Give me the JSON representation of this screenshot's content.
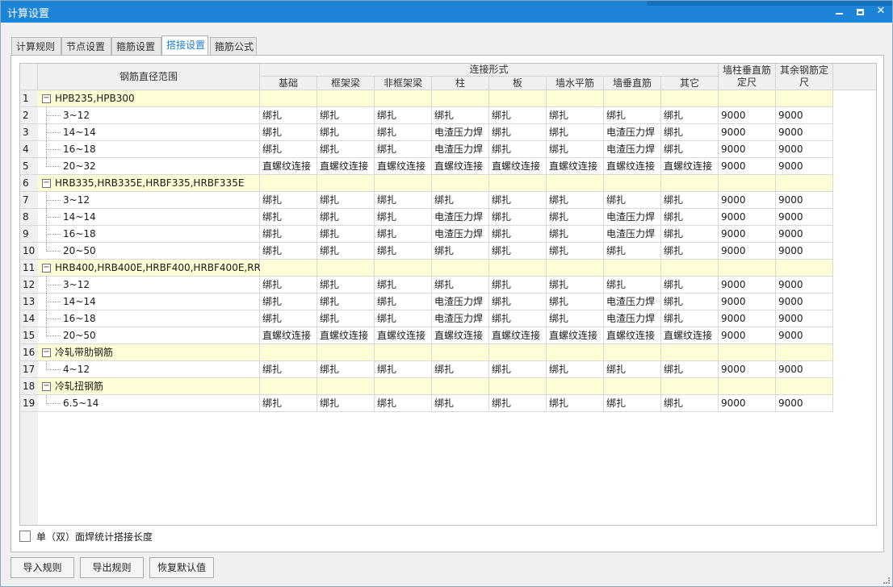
{
  "window": {
    "title": "计算设置"
  },
  "tabs": [
    {
      "label": "计算规则"
    },
    {
      "label": "节点设置"
    },
    {
      "label": "箍筋设置"
    },
    {
      "label": "搭接设置",
      "active": true
    },
    {
      "label": "箍筋公式"
    }
  ],
  "table": {
    "header": {
      "diameter_range": "钢筋直径范围",
      "connection_form": "连接形式",
      "columns": [
        "基础",
        "框架梁",
        "非框架梁",
        "柱",
        "板",
        "墙水平筋",
        "墙垂直筋",
        "其它"
      ],
      "wall_col_length": "墙柱垂直筋定尺",
      "other_length": "其余钢筋定尺"
    },
    "rows": [
      {
        "num": "1",
        "group": true,
        "label": "HPB235,HPB300"
      },
      {
        "num": "2",
        "label": "3~12",
        "cells": [
          "绑扎",
          "绑扎",
          "绑扎",
          "绑扎",
          "绑扎",
          "绑扎",
          "绑扎",
          "绑扎",
          "9000",
          "9000"
        ]
      },
      {
        "num": "3",
        "label": "14~14",
        "cells": [
          "绑扎",
          "绑扎",
          "绑扎",
          "电渣压力焊",
          "绑扎",
          "绑扎",
          "电渣压力焊",
          "绑扎",
          "9000",
          "9000"
        ]
      },
      {
        "num": "4",
        "label": "16~18",
        "cells": [
          "绑扎",
          "绑扎",
          "绑扎",
          "电渣压力焊",
          "绑扎",
          "绑扎",
          "电渣压力焊",
          "绑扎",
          "9000",
          "9000"
        ]
      },
      {
        "num": "5",
        "label": "20~32",
        "cells": [
          "直螺纹连接",
          "直螺纹连接",
          "直螺纹连接",
          "直螺纹连接",
          "直螺纹连接",
          "直螺纹连接",
          "直螺纹连接",
          "直螺纹连接",
          "9000",
          "9000"
        ]
      },
      {
        "num": "6",
        "group": true,
        "label": "HRB335,HRB335E,HRBF335,HRBF335E"
      },
      {
        "num": "7",
        "label": "3~12",
        "cells": [
          "绑扎",
          "绑扎",
          "绑扎",
          "绑扎",
          "绑扎",
          "绑扎",
          "绑扎",
          "绑扎",
          "9000",
          "9000"
        ]
      },
      {
        "num": "8",
        "label": "14~14",
        "cells": [
          "绑扎",
          "绑扎",
          "绑扎",
          "电渣压力焊",
          "绑扎",
          "绑扎",
          "电渣压力焊",
          "绑扎",
          "9000",
          "9000"
        ]
      },
      {
        "num": "9",
        "label": "16~18",
        "cells": [
          "绑扎",
          "绑扎",
          "绑扎",
          "电渣压力焊",
          "绑扎",
          "绑扎",
          "电渣压力焊",
          "绑扎",
          "9000",
          "9000"
        ]
      },
      {
        "num": "10",
        "label": "20~50",
        "cells": [
          "绑扎",
          "绑扎",
          "绑扎",
          "绑扎",
          "绑扎",
          "绑扎",
          "绑扎",
          "绑扎",
          "9000",
          "9000"
        ]
      },
      {
        "num": "11",
        "group": true,
        "label": "HRB400,HRB400E,HRBF400,HRBF400E,RR..."
      },
      {
        "num": "12",
        "label": "3~12",
        "cells": [
          "绑扎",
          "绑扎",
          "绑扎",
          "绑扎",
          "绑扎",
          "绑扎",
          "绑扎",
          "绑扎",
          "9000",
          "9000"
        ]
      },
      {
        "num": "13",
        "label": "14~14",
        "cells": [
          "绑扎",
          "绑扎",
          "绑扎",
          "电渣压力焊",
          "绑扎",
          "绑扎",
          "电渣压力焊",
          "绑扎",
          "9000",
          "9000"
        ]
      },
      {
        "num": "14",
        "label": "16~18",
        "cells": [
          "绑扎",
          "绑扎",
          "绑扎",
          "电渣压力焊",
          "绑扎",
          "绑扎",
          "电渣压力焊",
          "绑扎",
          "9000",
          "9000"
        ]
      },
      {
        "num": "15",
        "label": "20~50",
        "cells": [
          "直螺纹连接",
          "直螺纹连接",
          "直螺纹连接",
          "直螺纹连接",
          "直螺纹连接",
          "直螺纹连接",
          "直螺纹连接",
          "直螺纹连接",
          "9000",
          "9000"
        ]
      },
      {
        "num": "16",
        "group": true,
        "label": "冷轧带肋钢筋"
      },
      {
        "num": "17",
        "label": "4~12",
        "cells": [
          "绑扎",
          "绑扎",
          "绑扎",
          "绑扎",
          "绑扎",
          "绑扎",
          "绑扎",
          "绑扎",
          "9000",
          "9000"
        ]
      },
      {
        "num": "18",
        "group": true,
        "label": "冷轧扭钢筋"
      },
      {
        "num": "19",
        "label": "6.5~14",
        "cells": [
          "绑扎",
          "绑扎",
          "绑扎",
          "绑扎",
          "绑扎",
          "绑扎",
          "绑扎",
          "绑扎",
          "9000",
          "9000"
        ]
      }
    ]
  },
  "checkbox": {
    "label": "单（双）面焊统计搭接长度",
    "checked": false
  },
  "buttons": {
    "import": "导入规则",
    "export": "导出规则",
    "restore": "恢复默认值"
  },
  "icons": {
    "minimize": "minimize-icon",
    "maximize": "maximize-icon",
    "close": "close-icon",
    "expander": "collapse-icon"
  },
  "colors": {
    "titlebar": "#1c85d8",
    "group_row": "#fefdd5",
    "active_tab_text": "#1c7fd0"
  }
}
